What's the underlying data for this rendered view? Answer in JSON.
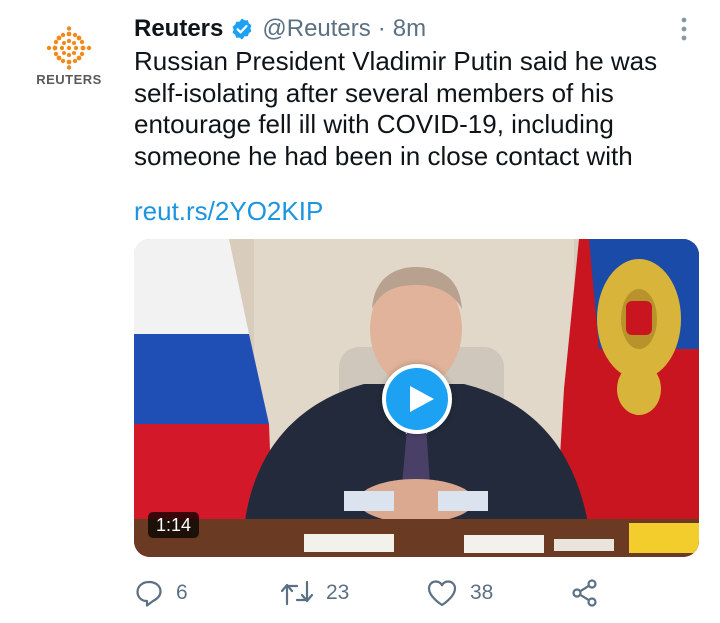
{
  "tweet": {
    "author_name": "Reuters",
    "handle": "@Reuters",
    "separator": "·",
    "time": "8m",
    "avatar_label": "REUTERS",
    "text_lines": [
      "Russian President Vladimir Putin said he was",
      "self-isolating after several members of his",
      "entourage fell ill with COVID-19, including",
      "someone he had been in close contact with"
    ],
    "link": "reut.rs/2YO2KIP"
  },
  "media": {
    "type": "video",
    "duration": "1:14"
  },
  "actions": {
    "reply_count": "6",
    "retweet_count": "23",
    "like_count": "38"
  },
  "colors": {
    "accent": "#1da1f2",
    "link": "#1b95e0",
    "secondary_text": "#5b7083",
    "brand_orange": "#f08a1c"
  },
  "icons": [
    "reuters-logo",
    "verified-badge-icon",
    "more-options-icon",
    "play-icon",
    "reply-icon",
    "retweet-icon",
    "like-icon",
    "share-icon"
  ]
}
